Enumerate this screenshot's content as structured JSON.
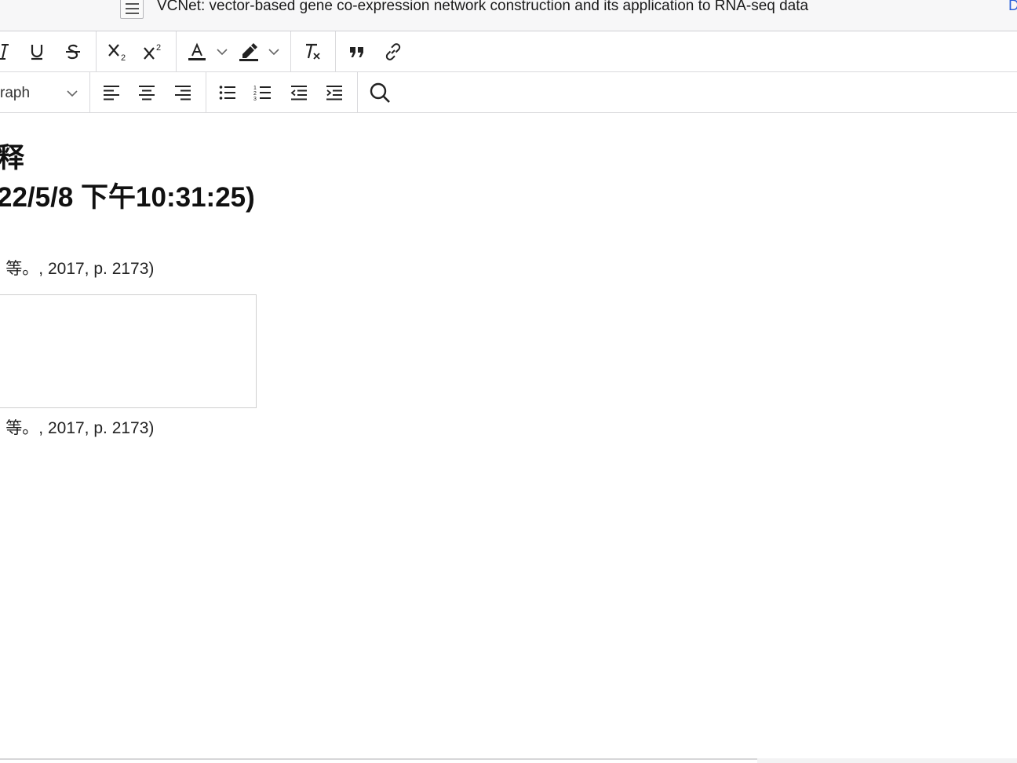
{
  "titlebar": {
    "title": "VCNet: vector-based gene co-expression network construction and its application to RNA-seq data",
    "edge_text": "D",
    "icon": "document-menu-icon"
  },
  "toolbar_row1": {
    "buttons": [
      "italic-icon",
      "underline-icon",
      "strikethrough-icon",
      "subscript-icon",
      "superscript-icon",
      "text-color-icon",
      "text-color-dropdown-icon",
      "highlight-icon",
      "highlight-dropdown-icon",
      "clear-formatting-icon",
      "blockquote-icon",
      "link-icon"
    ]
  },
  "toolbar_row2": {
    "paragraph_select": {
      "value": "raph"
    },
    "buttons": [
      "align-left-icon",
      "align-center-icon",
      "align-right-icon",
      "bulleted-list-icon",
      "numbered-list-icon",
      "outdent-icon",
      "indent-icon",
      "search-icon"
    ]
  },
  "content": {
    "heading_line1": "释",
    "heading_line2": "22/5/8 下午10:31:25)",
    "citation1": "| 等。, 2017, p. 2173)",
    "citation2": "| 等。, 2017, p. 2173)"
  },
  "colors": {
    "accent": "#2b5fd9",
    "text": "#111111",
    "toolbar_border": "#d9d9dc"
  }
}
